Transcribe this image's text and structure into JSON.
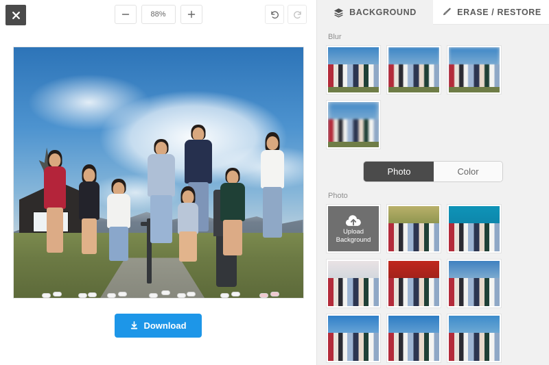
{
  "editor": {
    "close_label": "✕",
    "zoom": {
      "minus_label": "−",
      "level": "88%",
      "plus_label": "+"
    },
    "history": {
      "undo_name": "undo-icon",
      "redo_name": "redo-icon"
    },
    "download_label": "Download",
    "download_color": "#1d96e8"
  },
  "panel": {
    "tabs": [
      {
        "label": "BACKGROUND",
        "icon": "layers-icon",
        "active": true
      },
      {
        "label": "ERASE / RESTORE",
        "icon": "brush-icon",
        "active": false
      }
    ],
    "blur": {
      "label": "Blur",
      "items": [
        {
          "name": "blur-level-1",
          "level": 0
        },
        {
          "name": "blur-level-2",
          "level": 1
        },
        {
          "name": "blur-level-3",
          "level": 2
        },
        {
          "name": "blur-level-4",
          "level": 3
        }
      ]
    },
    "mode_toggle": {
      "options": [
        "Photo",
        "Color"
      ],
      "selected": "Photo"
    },
    "photo": {
      "label": "Photo",
      "upload_line1": "Upload",
      "upload_line2": "Background",
      "items": [
        {
          "name": "background-forest",
          "sky": "linear-gradient(#b9b06a,#7d8b45 55%,#55632f)"
        },
        {
          "name": "background-teal-studio",
          "sky": "linear-gradient(#0f94b8,#0d7fa4 60%,#0b6d8d)"
        },
        {
          "name": "background-city-skyline",
          "sky": "linear-gradient(#e9e2e4,#cfd6dc 45%,#8f9aa2)"
        },
        {
          "name": "background-autumn-red",
          "sky": "linear-gradient(#c0261c,#95201a 55%,#6c1d16)"
        },
        {
          "name": "background-mountain-cabin",
          "sky": "linear-gradient(#3f81c0,#8fb6d4 50%,#7d8d77)"
        },
        {
          "name": "background-blue-sky-clouds",
          "sky": "linear-gradient(#2f7fc8,#7fb3dc 55%,#bcd2e0)"
        },
        {
          "name": "background-golden-gate",
          "sky": "linear-gradient(#2d7cc4,#6fa8d6 50%,#9fbcd2)"
        },
        {
          "name": "background-coastal-cliff",
          "sky": "linear-gradient(#3d8ccb,#6fa9d4 40%,#c9b98a)"
        }
      ]
    }
  }
}
